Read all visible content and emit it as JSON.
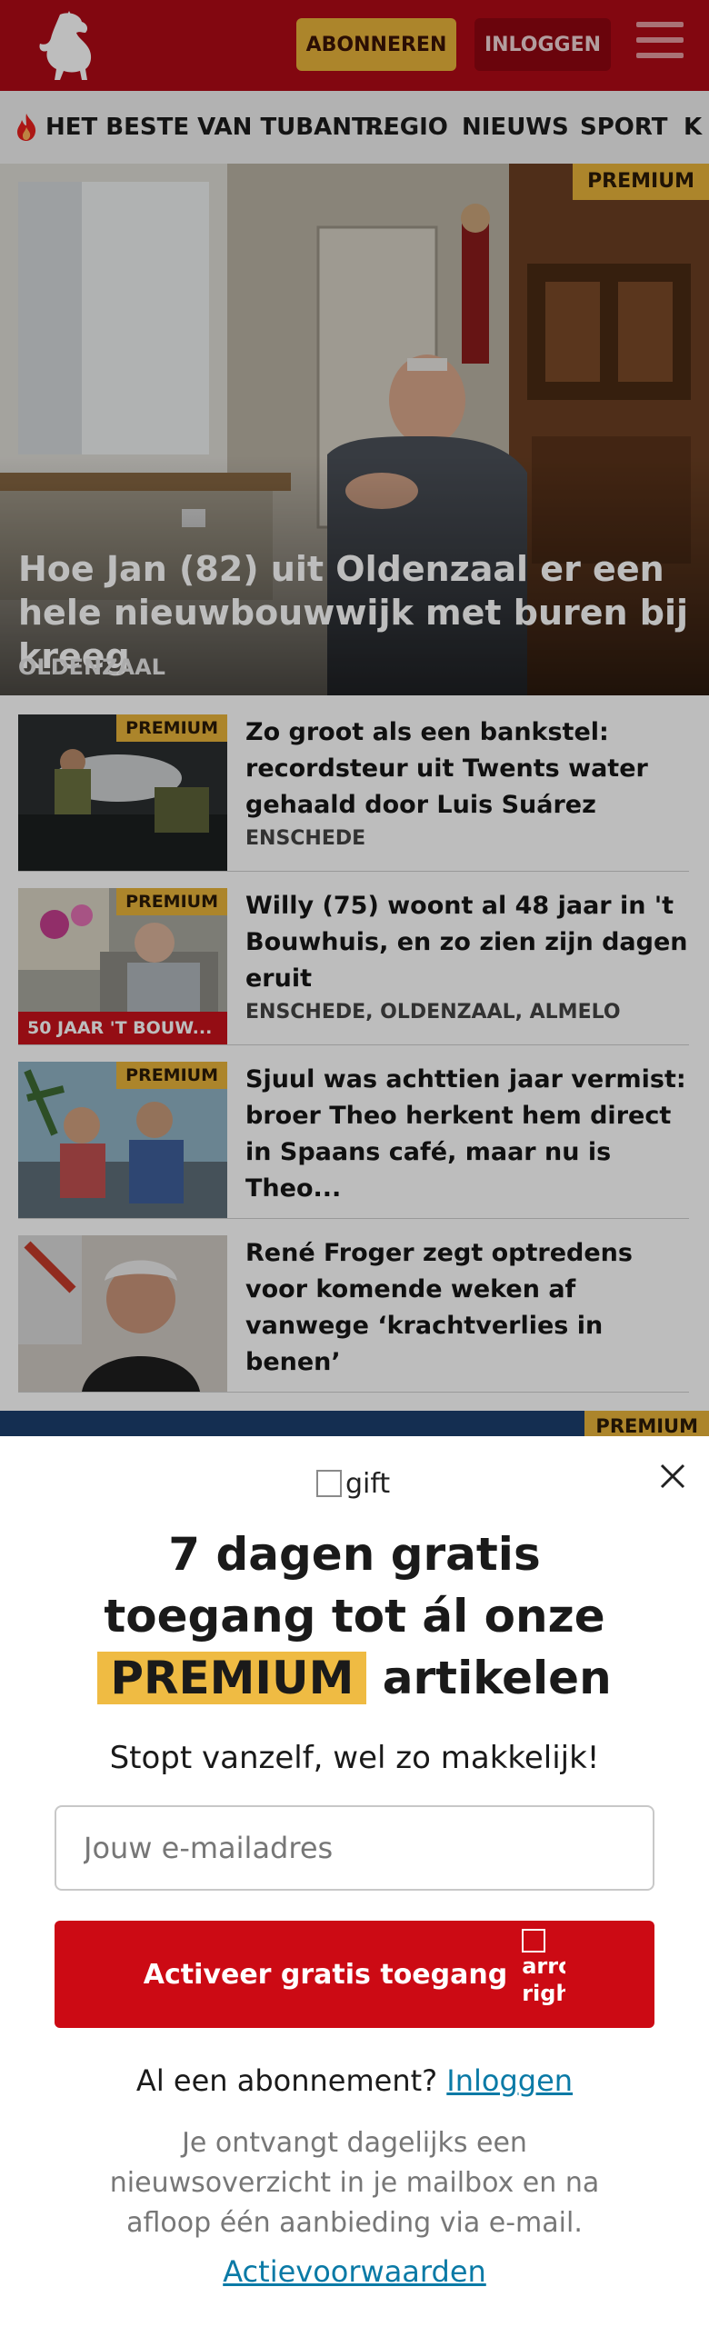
{
  "header": {
    "logo": "tubantia-horse-logo",
    "subscribe_label": "ABONNEREN",
    "login_label": "INLOGGEN",
    "menu_icon": "hamburger-menu-icon",
    "colors": {
      "brand_red": "#b00a16",
      "premium_yellow": "#e8b43a"
    }
  },
  "nav": {
    "items": [
      "HET BESTE VAN TUBANT...",
      "REGIO",
      "NIEUWS",
      "SPORT",
      "K"
    ]
  },
  "hero": {
    "badge": "PREMIUM",
    "title": "Hoe Jan (82) uit Oldenzaal er een hele nieuwbouwwijk met buren bij kreeg",
    "tag": "OLDENZAAL"
  },
  "articles": [
    {
      "badge": "PREMIUM",
      "title": "Zo groot als een bankstel: recordsteur uit Twents water gehaald door Luis Suárez",
      "tag": "ENSCHEDE"
    },
    {
      "badge": "PREMIUM",
      "series": "50 JAAR 'T BOUW...",
      "title": "Willy (75) woont al 48 jaar in 't Bouwhuis, en zo zien zijn dagen eruit",
      "tag": "ENSCHEDE, OLDENZAAL, ALMELO"
    },
    {
      "badge": "PREMIUM",
      "title": "Sjuul was achttien jaar vermist: broer Theo herkent hem direct in Spaans café, maar nu is Theo..."
    },
    {
      "title": "René Froger zegt optredens voor komende weken af vanwege ‘krachtverlies in benen’"
    }
  ],
  "peek_badge": "PREMIUM",
  "overlay": {
    "gift_alt": "gift",
    "headline_line1": "7 dagen gratis",
    "headline_line2": "toegang tot ál onze",
    "headline_highlight": "PREMIUM",
    "headline_end": "artikelen",
    "subline": "Stopt vanzelf, wel zo makkelijk!",
    "email_placeholder": "Jouw e-mailadres",
    "cta_label": "Activeer gratis toegang",
    "cta_icon_alt": "arrow-right",
    "already_text": "Al een abonnement?",
    "already_link": "Inloggen",
    "fineprint": "Je ontvangt dagelijks een nieuwsoverzicht in je mailbox en na afloop één aanbieding via e-mail.",
    "terms_link": "Actievoorwaarden"
  }
}
